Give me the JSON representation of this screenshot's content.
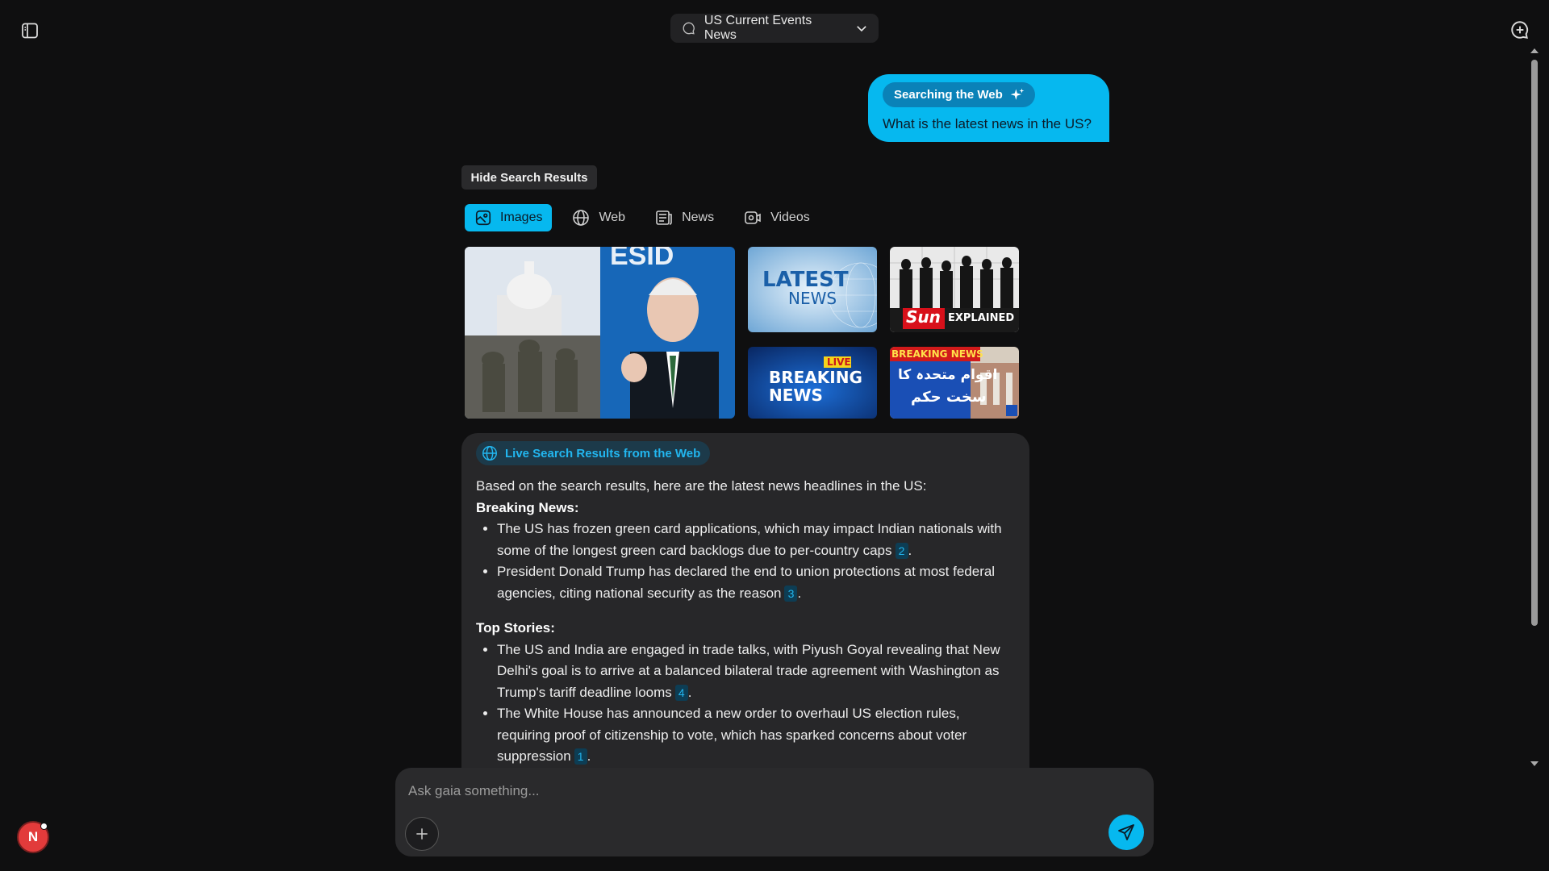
{
  "header": {
    "chat_title": "US Current Events News"
  },
  "user_message": {
    "mode_badge": "Searching the Web",
    "text": "What is the latest news in the US?"
  },
  "search_results": {
    "hide_label": "Hide Search Results",
    "tabs": [
      {
        "label": "Images",
        "icon": "image-icon",
        "active": true
      },
      {
        "label": "Web",
        "icon": "globe-icon",
        "active": false
      },
      {
        "label": "News",
        "icon": "newspaper-icon",
        "active": false
      },
      {
        "label": "Videos",
        "icon": "video-icon",
        "active": false
      }
    ],
    "image_texts": {
      "latest_1": "LATEST",
      "latest_2": "NEWS",
      "sun": "Sun",
      "explained": "EXPLAINED",
      "live": "LIVE",
      "breaking": "BREAKING",
      "news": "NEWS",
      "breaking_news": "BREAKING NEWS",
      "urdu_1": "اقوام متحدہ کا",
      "urdu_2": "سخت حکم"
    }
  },
  "answer": {
    "source_pill": "Live Search Results from the Web",
    "intro": "Based on the search results, here are the latest news headlines in the US:",
    "sections": [
      {
        "heading": "Breaking News:",
        "items": [
          {
            "text": "The US has frozen green card applications, which may impact Indian nationals with some of the longest green card backlogs due to per-country caps",
            "cite": "2"
          },
          {
            "text": "President Donald Trump has declared the end to union protections at most federal agencies, citing national security as the reason",
            "cite": "3"
          }
        ]
      },
      {
        "heading": "Top Stories:",
        "items": [
          {
            "text": "The US and India are engaged in trade talks, with Piyush Goyal revealing that New Delhi's goal is to arrive at a balanced bilateral trade agreement with Washington as Trump's tariff deadline looms",
            "cite": "4"
          },
          {
            "text": "The White House has announced a new order to overhaul US election rules, requiring proof of citizenship to vote, which has sparked concerns about voter suppression",
            "cite": "1"
          }
        ]
      }
    ]
  },
  "composer": {
    "placeholder": "Ask gaia something..."
  },
  "user": {
    "avatar_initial": "N"
  },
  "colors": {
    "accent": "#06b8ef",
    "background": "#0f0f10",
    "card": "#272729"
  }
}
